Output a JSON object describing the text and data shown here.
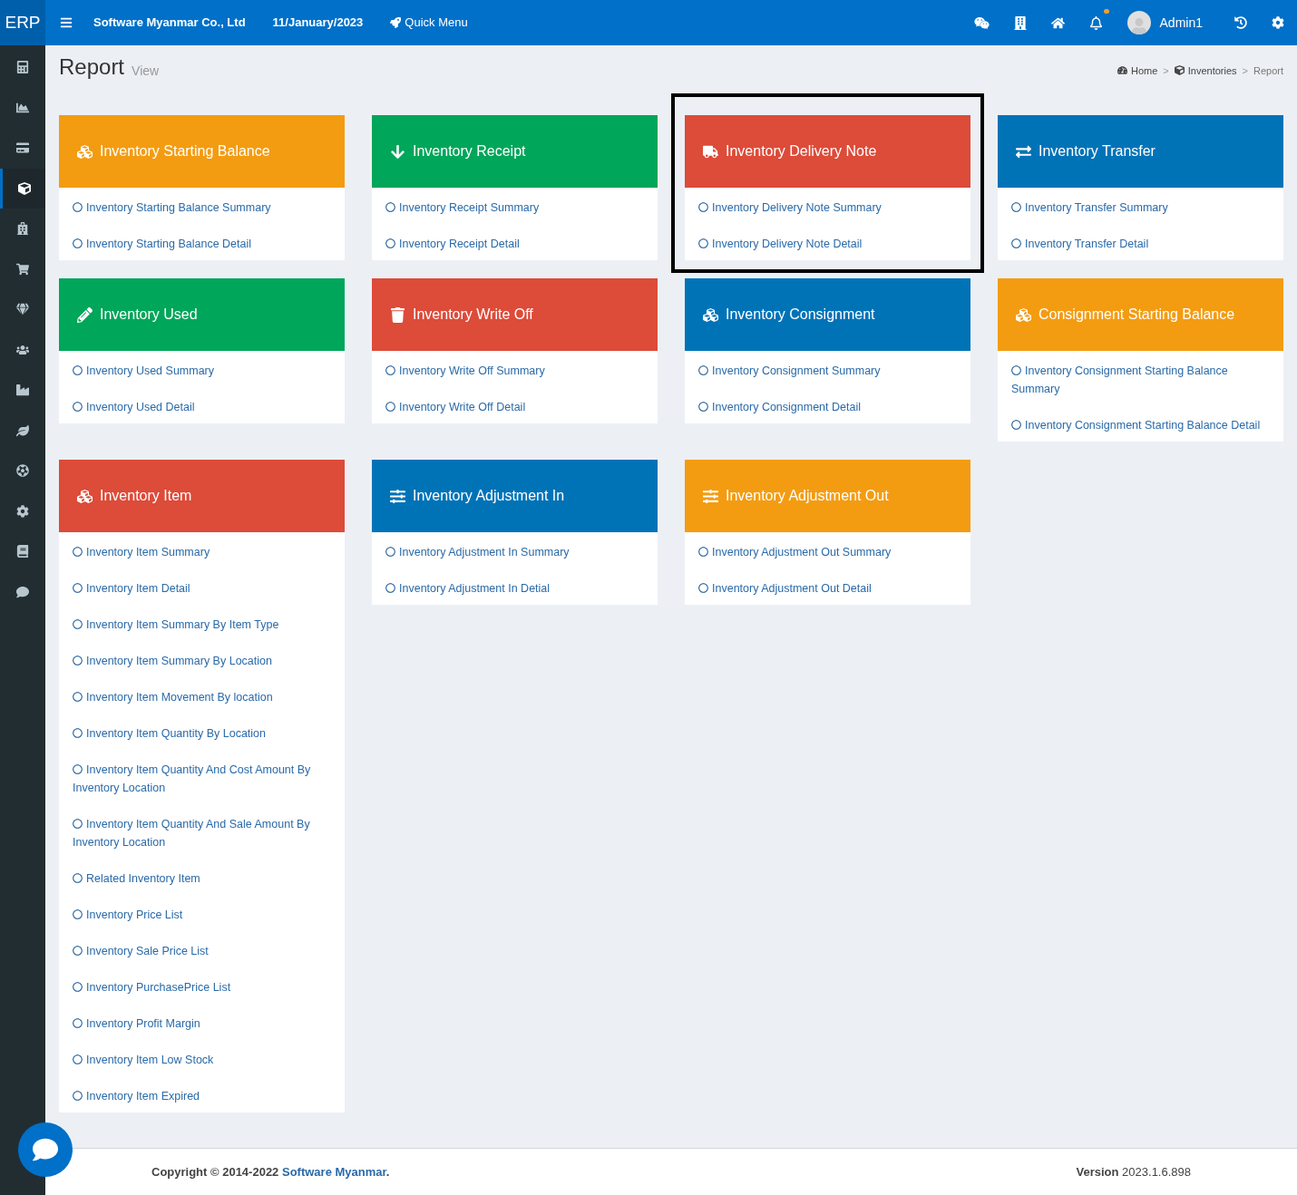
{
  "topbar": {
    "logo": "ERP",
    "company": "Software Myanmar Co., Ltd",
    "date": "11/January/2023",
    "quick_menu": "Quick Menu",
    "notification_dot": true,
    "user": "Admin1"
  },
  "sidebar": {
    "items": [
      {
        "selected": false
      },
      {
        "selected": false
      },
      {
        "selected": false
      },
      {
        "selected": true
      },
      {
        "selected": false
      },
      {
        "selected": false
      },
      {
        "selected": false
      },
      {
        "selected": false
      },
      {
        "selected": false
      },
      {
        "selected": false
      },
      {
        "selected": false
      },
      {
        "selected": false
      },
      {
        "selected": false
      },
      {
        "selected": false
      }
    ]
  },
  "page": {
    "title": "Report",
    "subtitle": "View"
  },
  "breadcrumb": [
    {
      "label": "Home"
    },
    {
      "separator": ">",
      "label": "Inventories"
    },
    {
      "separator": ">",
      "label": "Report"
    }
  ],
  "cards": [
    {
      "title": "Inventory Starting Balance",
      "color": "#f39c12",
      "highlighted": false,
      "links": [
        "Inventory Starting Balance Summary",
        "Inventory Starting Balance Detail"
      ]
    },
    {
      "title": "Inventory Receipt",
      "color": "#00a65a",
      "highlighted": false,
      "links": [
        "Inventory Receipt Summary",
        "Inventory Receipt Detail"
      ]
    },
    {
      "title": "Inventory Delivery Note",
      "color": "#dd4b39",
      "highlighted": true,
      "links": [
        "Inventory Delivery Note Summary",
        "Inventory Delivery Note Detail"
      ]
    },
    {
      "title": "Inventory Transfer",
      "color": "#0073b7",
      "highlighted": false,
      "links": [
        "Inventory Transfer Summary",
        "Inventory Transfer Detail"
      ]
    },
    {
      "title": "Inventory Used",
      "color": "#00a65a",
      "highlighted": false,
      "links": [
        "Inventory Used Summary",
        "Inventory Used Detail"
      ]
    },
    {
      "title": "Inventory Write Off",
      "color": "#dd4b39",
      "highlighted": false,
      "links": [
        "Inventory Write Off Summary",
        "Inventory Write Off Detail"
      ]
    },
    {
      "title": "Inventory Consignment",
      "color": "#0073b7",
      "highlighted": false,
      "links": [
        "Inventory Consignment Summary",
        "Inventory Consignment Detail"
      ]
    },
    {
      "title": "Consignment Starting Balance",
      "color": "#f39c12",
      "highlighted": false,
      "links": [
        "Inventory Consignment Starting Balance Summary",
        "Inventory Consignment Starting Balance Detail"
      ]
    },
    {
      "title": "Inventory Item",
      "color": "#dd4b39",
      "highlighted": false,
      "links": [
        "Inventory Item Summary",
        "Inventory Item Detail",
        "Inventory Item Summary By Item Type",
        "Inventory Item Summary By Location",
        "Inventory Item Movement By location",
        "Inventory Item Quantity By Location",
        "Inventory Item Quantity And Cost Amount By Inventory Location",
        "Inventory Item Quantity And Sale Amount By Inventory Location",
        "Related Inventory Item",
        "Inventory Price List",
        "Inventory Sale Price List",
        "Inventory PurchasePrice List",
        "Inventory Profit Margin",
        "Inventory Item Low Stock",
        "Inventory Item Expired"
      ]
    },
    {
      "title": "Inventory Adjustment In",
      "color": "#0073b7",
      "highlighted": false,
      "links": [
        "Inventory Adjustment In Summary",
        "Inventory Adjustment In Detial"
      ]
    },
    {
      "title": "Inventory Adjustment Out",
      "color": "#f39c12",
      "highlighted": false,
      "links": [
        "Inventory Adjustment Out Summary",
        "Inventory Adjustment Out Detail"
      ]
    }
  ],
  "footer": {
    "copyright": "Copyright © 2014-2022",
    "company_link": "Software Myanmar",
    "period": ".",
    "version_label": "Version",
    "version": "2023.1.6.898"
  }
}
